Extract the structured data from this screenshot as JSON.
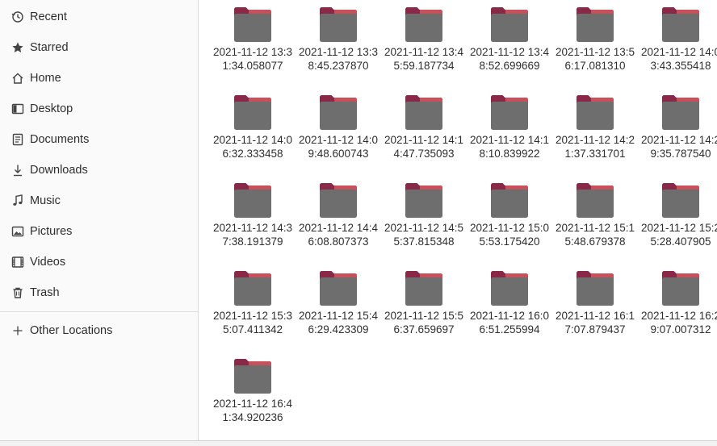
{
  "sidebar": {
    "items": [
      {
        "label": "Recent",
        "icon": "clock-icon"
      },
      {
        "label": "Starred",
        "icon": "star-icon"
      },
      {
        "label": "Home",
        "icon": "home-icon"
      },
      {
        "label": "Desktop",
        "icon": "desktop-icon"
      },
      {
        "label": "Documents",
        "icon": "document-icon"
      },
      {
        "label": "Downloads",
        "icon": "download-icon"
      },
      {
        "label": "Music",
        "icon": "music-icon"
      },
      {
        "label": "Pictures",
        "icon": "picture-icon"
      },
      {
        "label": "Videos",
        "icon": "video-icon"
      },
      {
        "label": "Trash",
        "icon": "trash-icon"
      }
    ],
    "other_locations": {
      "label": "Other Locations",
      "icon": "plus-icon"
    }
  },
  "files": [
    {
      "name": "2021-11-12 13:31:34.058077"
    },
    {
      "name": "2021-11-12 13:38:45.237870"
    },
    {
      "name": "2021-11-12 13:45:59.187734"
    },
    {
      "name": "2021-11-12 13:48:52.699669"
    },
    {
      "name": "2021-11-12 13:56:17.081310"
    },
    {
      "name": "2021-11-12 14:03:43.355418"
    },
    {
      "name": "2021-11-12 14:06:32.333458"
    },
    {
      "name": "2021-11-12 14:09:48.600743"
    },
    {
      "name": "2021-11-12 14:14:47.735093"
    },
    {
      "name": "2021-11-12 14:18:10.839922"
    },
    {
      "name": "2021-11-12 14:21:37.331701"
    },
    {
      "name": "2021-11-12 14:29:35.787540"
    },
    {
      "name": "2021-11-12 14:37:38.191379"
    },
    {
      "name": "2021-11-12 14:46:08.807373"
    },
    {
      "name": "2021-11-12 14:55:37.815348"
    },
    {
      "name": "2021-11-12 15:05:53.175420"
    },
    {
      "name": "2021-11-12 15:15:48.679378"
    },
    {
      "name": "2021-11-12 15:25:28.407905"
    },
    {
      "name": "2021-11-12 15:35:07.411342"
    },
    {
      "name": "2021-11-12 15:46:29.423309"
    },
    {
      "name": "2021-11-12 15:56:37.659697"
    },
    {
      "name": "2021-11-12 16:06:51.255994"
    },
    {
      "name": "2021-11-12 16:17:07.879437"
    },
    {
      "name": "2021-11-12 16:29:07.007312"
    },
    {
      "name": "2021-11-12 16:41:34.920236"
    }
  ],
  "colors": {
    "folder_tab": "#c7505a",
    "folder_back": "#8a2848",
    "folder_front": "#6e6e6e"
  }
}
